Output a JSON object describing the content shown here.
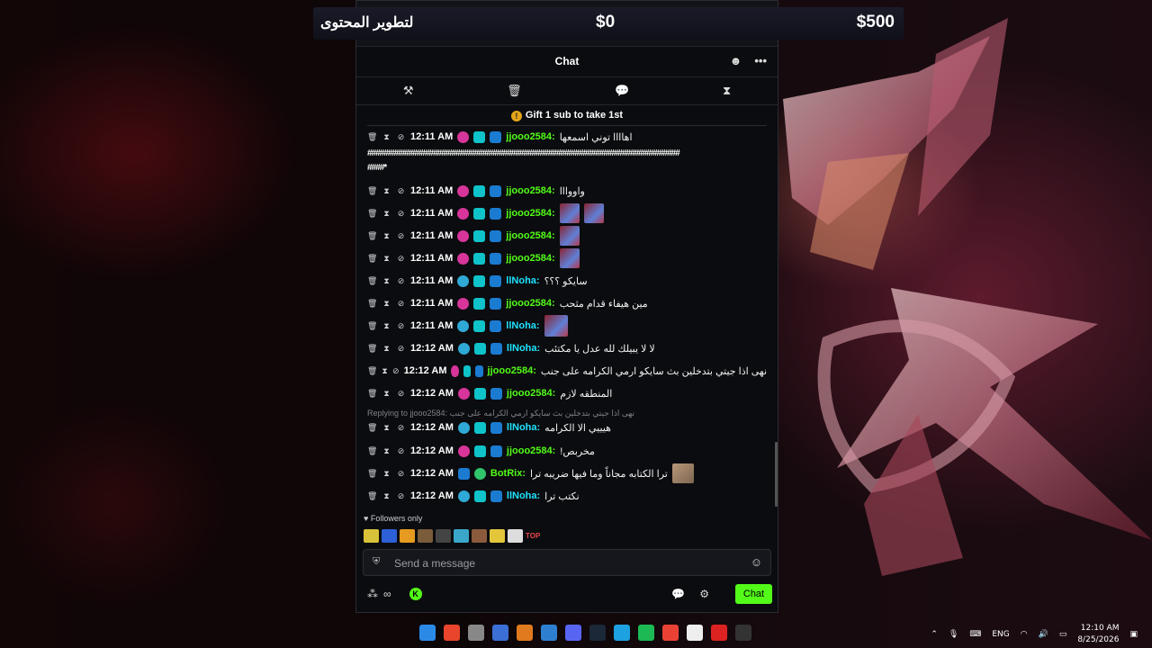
{
  "donation": {
    "goal_label": "لتطوير المحتوى",
    "current": "$0",
    "target": "$500"
  },
  "chat": {
    "title": "Chat",
    "pinned": "Gift 1 sub to take 1st",
    "messages": [
      {
        "time": "12:11 AM",
        "user": "jjooo2584:",
        "text": "اهاااا توني اسمعها"
      },
      {
        "time": "12:11 AM",
        "user": "jjooo2584:",
        "text": "واووااا"
      },
      {
        "time": "12:11 AM",
        "user": "jjooo2584:",
        "text": ""
      },
      {
        "time": "12:11 AM",
        "user": "jjooo2584:",
        "text": ""
      },
      {
        "time": "12:11 AM",
        "user": "jjooo2584:",
        "text": ""
      },
      {
        "time": "12:11 AM",
        "user": "llNoha:",
        "text": "سايكو ؟؟؟"
      },
      {
        "time": "12:11 AM",
        "user": "jjooo2584:",
        "text": "مين هيفاء قدام مثحب"
      },
      {
        "time": "12:11 AM",
        "user": "llNoha:",
        "text": ""
      },
      {
        "time": "12:12 AM",
        "user": "llNoha:",
        "text": "لا لا يبيلك لله عدل يا مكتئب"
      },
      {
        "time": "12:12 AM",
        "user": "jjooo2584:",
        "text": "نهى اذا جيتي بتدخلين بث سايكو ارمي الكرامه على جنب"
      },
      {
        "time": "12:12 AM",
        "user": "jjooo2584:",
        "text": "المنطقه لازم"
      },
      {
        "time": "12:12 AM",
        "user": "llNoha:",
        "text": "هيييي الا الكرامه"
      },
      {
        "time": "12:12 AM",
        "user": "jjooo2584:",
        "text": "مخربص!"
      },
      {
        "time": "12:12 AM",
        "user": "BotRix:",
        "text": "ترا الكتابه مجاناً وما فيها ضريبه ترا"
      },
      {
        "time": "12:12 AM",
        "user": "llNoha:",
        "text": "نكتب ترا"
      }
    ],
    "hashes": "############################################################################",
    "hashes2": "####*",
    "reply": "Replying to jjooo2584: نهى اذا جيتي بتدخلين بث سايكو ارمي الكرامه على جنب",
    "followers_only": "Followers only",
    "emote_text": "TOP",
    "input_placeholder": "Send a message",
    "send_label": "Chat"
  },
  "taskbar": {
    "lang": "ENG",
    "time": "12:10 AM",
    "date": "8/25/2026"
  }
}
